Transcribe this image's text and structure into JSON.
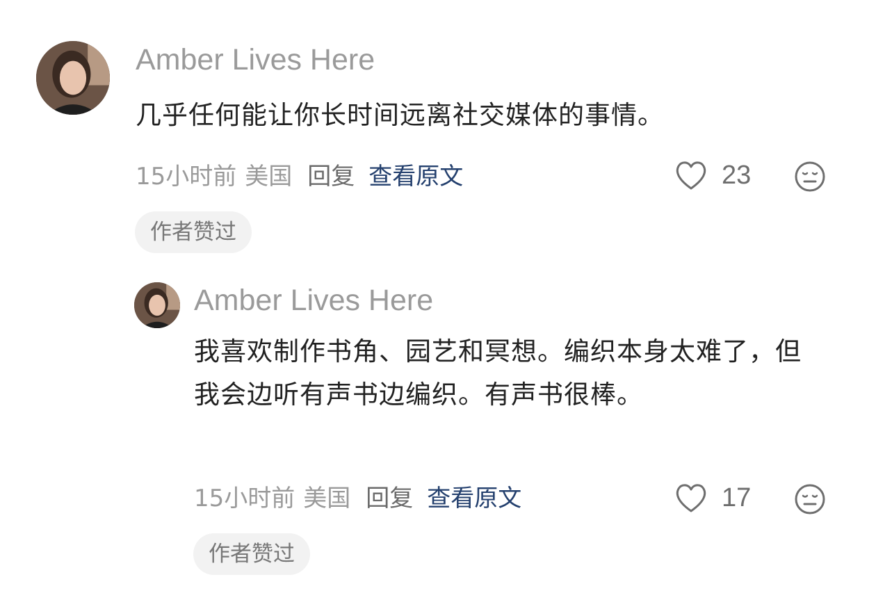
{
  "comments": [
    {
      "username": "Amber Lives Here",
      "text": "几乎任何能让你长时间远离社交媒体的事情。",
      "time": "15小时前",
      "region": "美国",
      "reply_label": "回复",
      "view_original_label": "查看原文",
      "likes": "23",
      "badge": "作者赞过"
    },
    {
      "username": "Amber Lives Here",
      "text": "我喜欢制作书角、园艺和冥想。编织本身太难了，但我会边听有声书边编织。有声书很棒。",
      "time": "15小时前",
      "region": "美国",
      "reply_label": "回复",
      "view_original_label": "查看原文",
      "likes": "17",
      "badge": "作者赞过"
    }
  ],
  "colors": {
    "link": "#24406e",
    "meta": "#9a9a9a",
    "badge_bg": "#f2f2f2"
  },
  "icons": {
    "like": "heart-outline-icon",
    "reaction": "neutral-face-icon"
  }
}
